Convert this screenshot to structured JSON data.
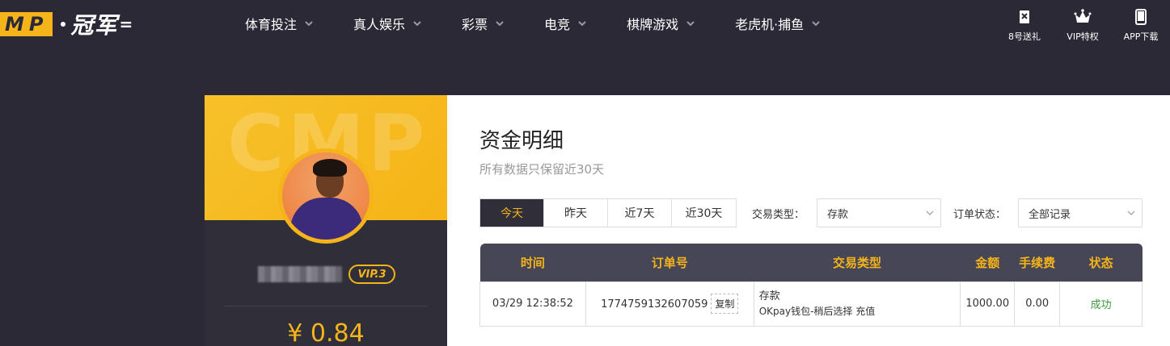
{
  "header": {
    "logo_letters": [
      "M",
      "P"
    ],
    "logo_cn": "冠军",
    "nav": [
      {
        "label": "体育投注"
      },
      {
        "label": "真人娱乐"
      },
      {
        "label": "彩票"
      },
      {
        "label": "电竞"
      },
      {
        "label": "棋牌游戏"
      },
      {
        "label": "老虎机·捕鱼"
      }
    ],
    "right": [
      {
        "label": "8号送礼",
        "icon": "ticket-icon"
      },
      {
        "label": "VIP特权",
        "icon": "crown-icon"
      },
      {
        "label": "APP下载",
        "icon": "phone-icon"
      }
    ]
  },
  "profile": {
    "watermark": "CMP",
    "vip_label": "VIP.3",
    "balance": "¥ 0.84"
  },
  "panel": {
    "title": "资金明细",
    "subtitle": "所有数据只保留近30天",
    "tabs": [
      "今天",
      "昨天",
      "近7天",
      "近30天"
    ],
    "active_tab": "今天",
    "filters": {
      "type_label": "交易类型：",
      "type_value": "存款",
      "status_label": "订单状态：",
      "status_value": "全部记录"
    },
    "table": {
      "headers": [
        "时间",
        "订单号",
        "交易类型",
        "金额",
        "手续费",
        "状态"
      ],
      "rows": [
        {
          "time": "03/29 12:38:52",
          "order_no": "1774759132607059",
          "copy_label": "复制",
          "type_main": "存款",
          "type_sub": "OKpay钱包-稍后选择 充值",
          "amount": "1000.00",
          "fee": "0.00",
          "status": "成功"
        }
      ]
    }
  },
  "colors": {
    "bg": "#2a2935",
    "accent": "#f5b41a",
    "table_header": "#474656",
    "success": "#3a9a3a"
  }
}
